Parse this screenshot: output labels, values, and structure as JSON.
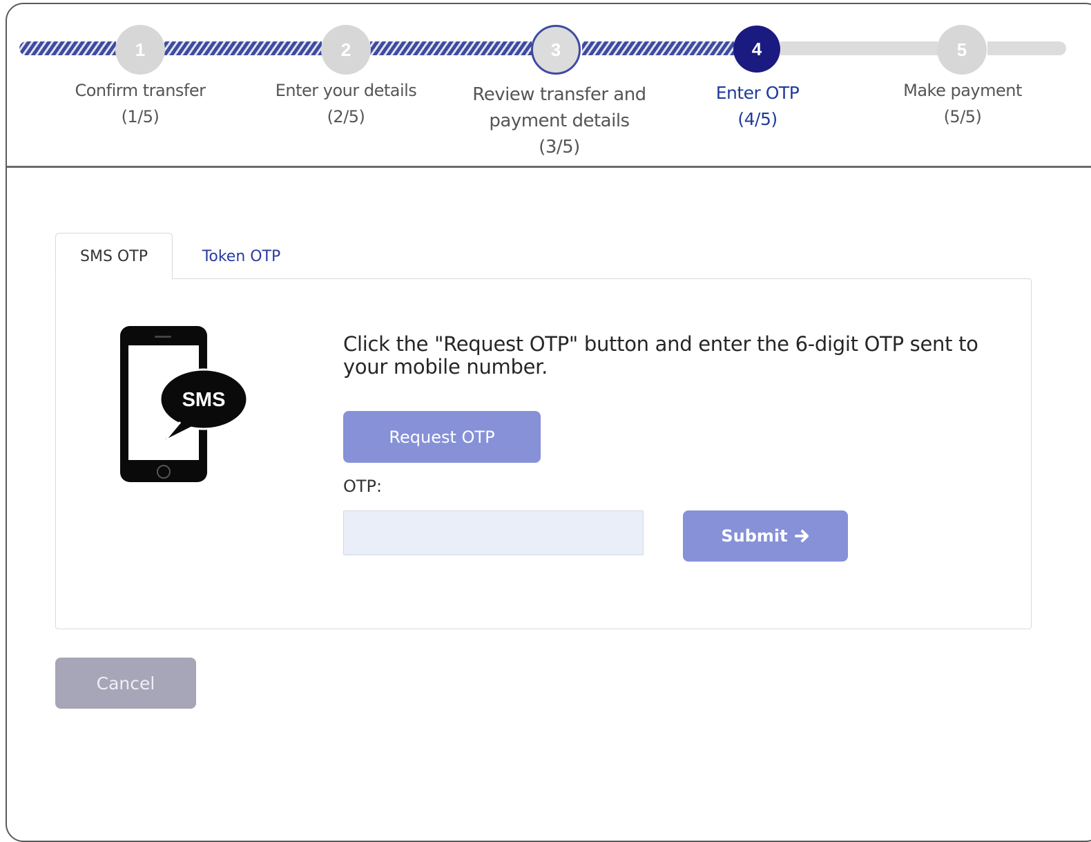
{
  "stepper": {
    "steps": [
      {
        "number": "1",
        "label_line1": "Confirm transfer",
        "label_line2": "(1/5)",
        "state": "completed"
      },
      {
        "number": "2",
        "label_line1": "Enter your details",
        "label_line2": "(2/5)",
        "state": "completed"
      },
      {
        "number": "3",
        "label_line1": "Review transfer and",
        "label_line2": "payment details",
        "label_line3": "(3/5)",
        "state": "completed"
      },
      {
        "number": "4",
        "label_line1": "Enter OTP",
        "label_line2": "(4/5)",
        "state": "current"
      },
      {
        "number": "5",
        "label_line1": "Make payment",
        "label_line2": "(5/5)",
        "state": "upcoming"
      }
    ]
  },
  "tabs": [
    {
      "label": "SMS OTP",
      "active": true
    },
    {
      "label": "Token OTP",
      "active": false
    }
  ],
  "sms_panel": {
    "icon_text": "SMS",
    "instruction": "Click the \"Request OTP\" button and enter the 6-digit OTP sent to your mobile number.",
    "request_button": "Request OTP",
    "otp_label": "OTP:",
    "otp_value": "",
    "submit_button": "Submit",
    "submit_icon": "arrow-right-icon"
  },
  "cancel_button": "Cancel",
  "colors": {
    "primary_button": "#8691d8",
    "current_step": "#1a1a80",
    "link_blue": "#2a3aa0",
    "cancel_button": "#a7a6b8",
    "input_bg": "#e9eef8"
  }
}
